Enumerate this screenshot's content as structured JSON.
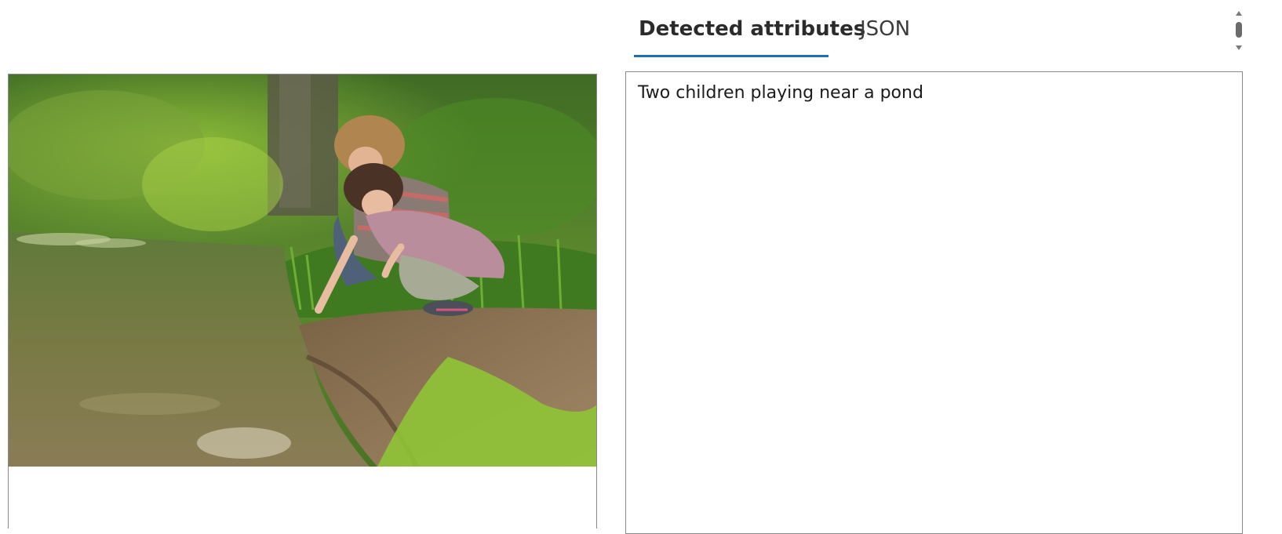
{
  "tabs": [
    {
      "label": "Detected attributes",
      "active": true
    },
    {
      "label": "JSON",
      "active": false
    }
  ],
  "result": {
    "caption": "Two children playing near a pond"
  },
  "colors": {
    "accent": "#1f6fb5",
    "border": "#8a8a8a"
  }
}
